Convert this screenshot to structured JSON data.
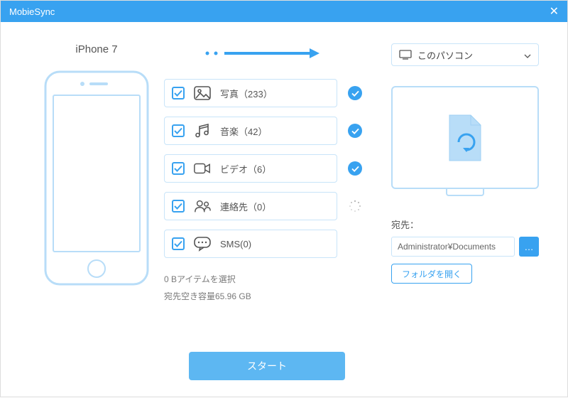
{
  "app": {
    "title": "MobieSync"
  },
  "device": {
    "name": "iPhone 7"
  },
  "categories": [
    {
      "label": "写真（233）",
      "status": "done",
      "icon": "photo"
    },
    {
      "label": "音楽（42）",
      "status": "done",
      "icon": "music"
    },
    {
      "label": "ビデオ（6）",
      "status": "done",
      "icon": "video"
    },
    {
      "label": "連絡先（0）",
      "status": "loading",
      "icon": "contacts"
    },
    {
      "label": "SMS(0)",
      "status": "none",
      "icon": "sms"
    }
  ],
  "info": {
    "selected": "0 Bアイテムを選択",
    "freespace": "宛先空き容量65.96 GB"
  },
  "destination": {
    "selector": "このパソコン",
    "label": "宛先：",
    "path": "Administrator¥Documents",
    "browse": "…",
    "open_folder": "フォルダを開く"
  },
  "actions": {
    "start": "スタート"
  }
}
